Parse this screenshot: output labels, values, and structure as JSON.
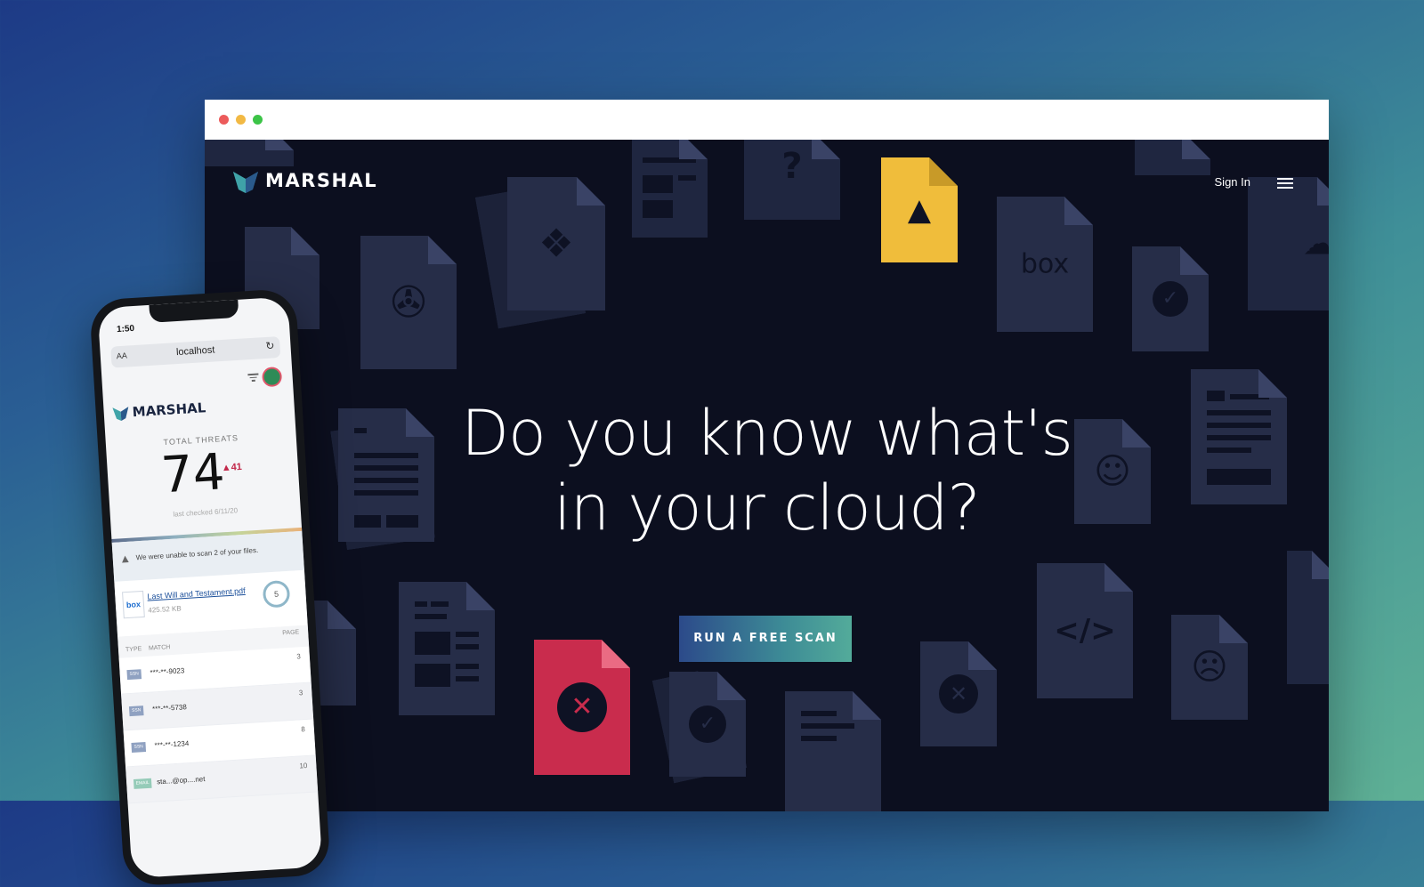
{
  "browser": {
    "window_dots": [
      "close",
      "minimize",
      "maximize"
    ]
  },
  "site": {
    "logo_text": "MARSHAL",
    "sign_in": "Sign In",
    "headline_line1": "Do you know what's",
    "headline_line2": "in your cloud?",
    "cta": "RUN A FREE SCAN"
  },
  "decor": {
    "box_label": "box",
    "question": "?",
    "code": "</>"
  },
  "phone": {
    "time": "1:50",
    "url": "localhost",
    "aa": "AA",
    "logo_text": "MARSHAL",
    "total_label": "TOTAL THREATS",
    "total_value": "74",
    "delta": "▲41",
    "last_checked": "last checked 6/11/20",
    "warning": "We were unable to scan 2 of your files.",
    "file_name": "Last Will and Testament.pdf",
    "file_size": "425.52 KB",
    "file_source": "box",
    "file_count": "5",
    "columns": {
      "type": "TYPE",
      "match": "MATCH",
      "page": "PAGE"
    },
    "rows": [
      {
        "type": "SSN",
        "match": "***-**-9023",
        "page": "3"
      },
      {
        "type": "SSN",
        "match": "***-**-5738",
        "page": "3"
      },
      {
        "type": "SSN",
        "match": "***-**-1234",
        "page": "8"
      },
      {
        "type": "EMAIL",
        "match": "sta...@op....net",
        "page": "10"
      }
    ]
  },
  "colors": {
    "accent_yellow": "#f0bd3b",
    "accent_red": "#c92c4d",
    "cta_start": "#2c4a8a",
    "cta_end": "#53ab9a",
    "page_bg": "#0c0f1f"
  }
}
